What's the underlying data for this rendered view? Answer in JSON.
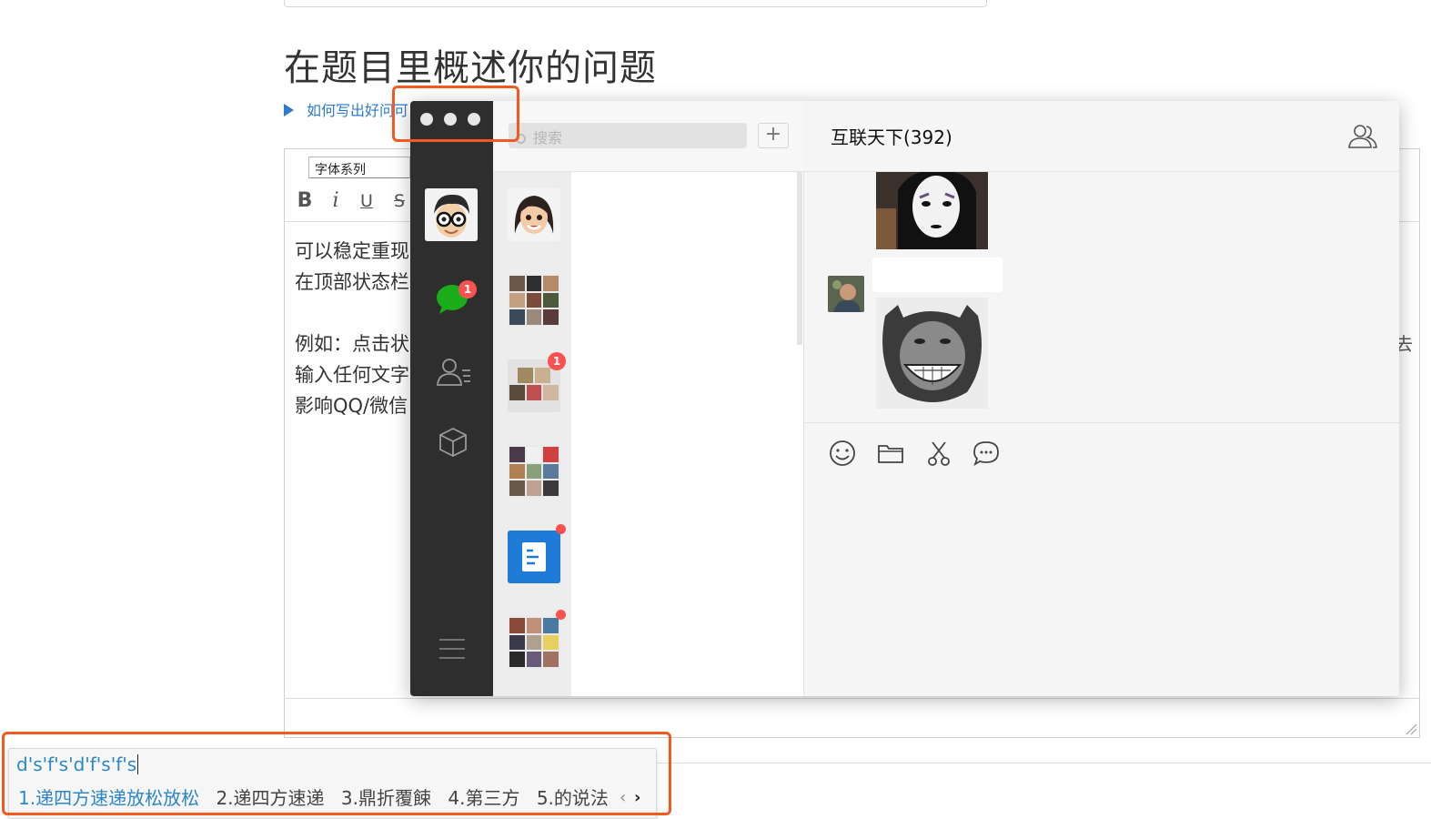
{
  "page": {
    "title": "在题目里概述你的问题",
    "help_link": "如何写出好问",
    "help_link_cut": "可"
  },
  "editor": {
    "font_select": "字体系列",
    "format": {
      "bold": "B",
      "italic": "i",
      "underline": "U",
      "strike": "S"
    },
    "lines": [
      "可以稳定重现",
      "在顶部状态栏",
      "例如：点击状",
      "输入任何文字",
      "影响QQ/微信"
    ],
    "right_glimpse": "去"
  },
  "wechat": {
    "search_placeholder": "搜索",
    "add_label": "+",
    "sidebar_badge": "1",
    "chat_title": "互联天下(392)",
    "list_items": [
      {
        "type": "avatar",
        "badge": ""
      },
      {
        "type": "group",
        "badge": ""
      },
      {
        "type": "group",
        "badge": "1"
      },
      {
        "type": "group",
        "badge": ""
      },
      {
        "type": "doc",
        "badge": "dot"
      },
      {
        "type": "group",
        "badge": "dot"
      }
    ],
    "colors": {
      "sidebar": "#2e2e2e",
      "badge": "#fa5151",
      "chat_green": "#1aad19",
      "doc_blue": "#1f7bd8"
    }
  },
  "ime": {
    "input": "d's'f's'd'f's'f's",
    "candidates": [
      "1.递四方速递放松放松",
      "2.递四方速递",
      "3.鼎折覆餗",
      "4.第三方",
      "5.的说法"
    ],
    "prev": "‹",
    "next": "›"
  },
  "highlight_color": "#f25a24"
}
